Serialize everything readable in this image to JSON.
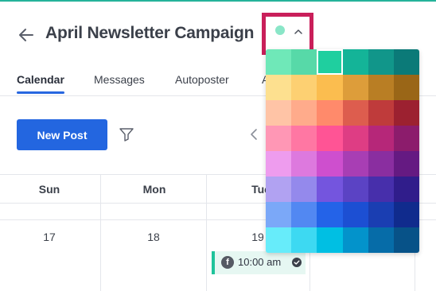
{
  "header": {
    "title": "April Newsletter Campaign",
    "back_icon": "arrow-left-icon",
    "color_picker": {
      "selected_color": "#8ae6c8",
      "chevron_icon": "chevron-up-icon"
    }
  },
  "tabs": [
    {
      "label": "Calendar",
      "active": true
    },
    {
      "label": "Messages",
      "active": false
    },
    {
      "label": "Autoposter",
      "active": false
    },
    {
      "label": "A",
      "active": false
    }
  ],
  "toolbar": {
    "new_post_label": "New Post",
    "filter_icon": "funnel-icon",
    "prev_icon": "chevron-left-icon"
  },
  "calendar": {
    "day_names": [
      "Sun",
      "Mon",
      "Tue"
    ],
    "dates": [
      "17",
      "18",
      "19"
    ],
    "event": {
      "network_icon": "facebook-icon",
      "time": "10:00 am",
      "status_icon": "check-circle-icon"
    }
  },
  "palette": {
    "selected_index": 2,
    "colors": [
      "#6fe8b8",
      "#57d9a8",
      "#1fcf9f",
      "#14b498",
      "#11968a",
      "#0b7a78",
      "#fde08f",
      "#fdd072",
      "#fbbd4f",
      "#dd9d3a",
      "#b97e24",
      "#9a6617",
      "#ffc4a6",
      "#ffab8b",
      "#ff8a6b",
      "#dd5d4e",
      "#bf3b3b",
      "#9c2130",
      "#ff97b5",
      "#ff77a3",
      "#ff5495",
      "#de3d84",
      "#b62779",
      "#8c1c6c",
      "#ee9cee",
      "#dd79de",
      "#ce4fce",
      "#a83eb4",
      "#8a2ea0",
      "#651a82",
      "#b1a2f2",
      "#9489ec",
      "#7455de",
      "#5b43c4",
      "#472fab",
      "#301d8b",
      "#7ba8f8",
      "#5288f2",
      "#2463e8",
      "#1c4fd3",
      "#1a3eb2",
      "#102b8d",
      "#67ecfa",
      "#3dd9f2",
      "#00bfe3",
      "#0393cb",
      "#066ca8",
      "#075288"
    ]
  }
}
